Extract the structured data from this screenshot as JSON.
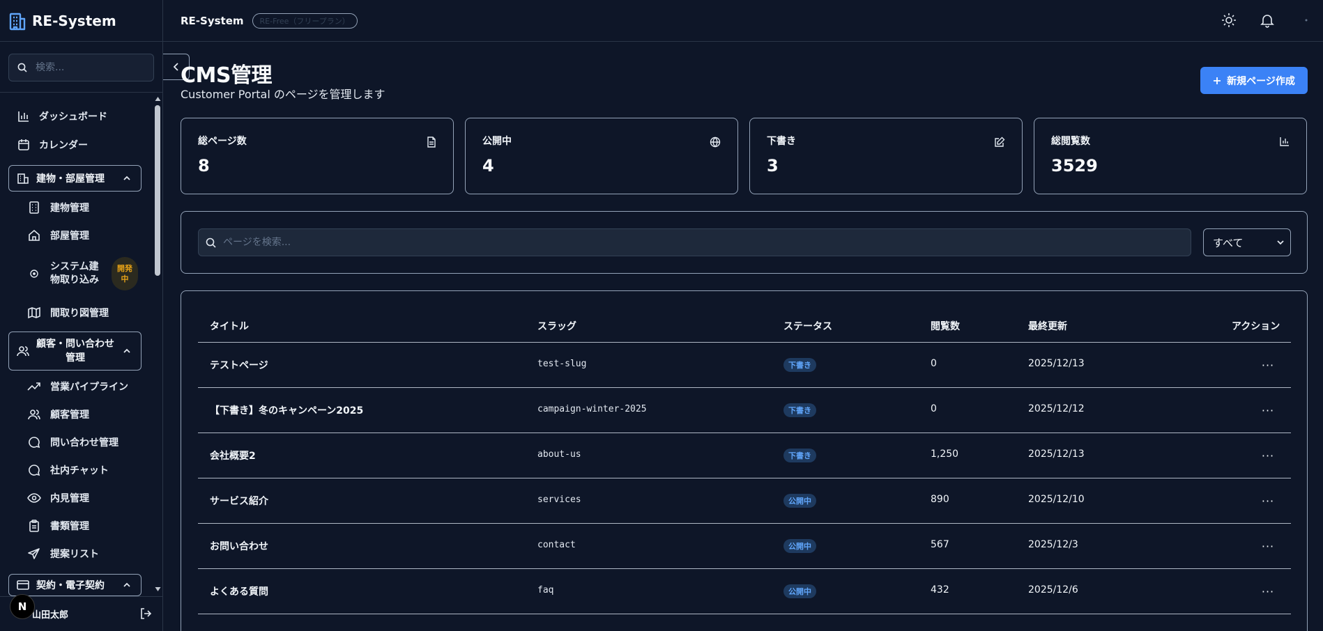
{
  "app": {
    "brand": "RE-System",
    "search_placeholder": "検索...",
    "user_name": "山田太郎",
    "next_badge": "N"
  },
  "nav": {
    "dashboard": "ダッシュボード",
    "calendar": "カレンダー",
    "group_building": "建物・部屋管理",
    "building": "建物管理",
    "room": "部屋管理",
    "import_line1": "システム建",
    "import_line2": "物取り込み",
    "dev_badge": "開発中",
    "floorplan": "間取り図管理",
    "group_customer_line1": "顧客・問い合わせ",
    "group_customer_line2": "管理",
    "pipeline": "営業パイプライン",
    "customers": "顧客管理",
    "inquiries": "問い合わせ管理",
    "chat": "社内チャット",
    "viewing": "内見管理",
    "documents": "書類管理",
    "proposals": "提案リスト",
    "group_contract": "契約・電子契約"
  },
  "topbar": {
    "title": "RE-System",
    "plan_badge": "RE-Free（フリープラン）"
  },
  "page": {
    "title": "CMS管理",
    "subtitle": "Customer Portal のページを管理します",
    "new_button": "新規ページ作成"
  },
  "stats": [
    {
      "label": "総ページ数",
      "value": "8",
      "icon": "file-text-icon"
    },
    {
      "label": "公開中",
      "value": "4",
      "icon": "globe-icon"
    },
    {
      "label": "下書き",
      "value": "3",
      "icon": "edit-icon"
    },
    {
      "label": "総閲覧数",
      "value": "3529",
      "icon": "bar-chart-icon"
    }
  ],
  "filter": {
    "search_placeholder": "ページを検索...",
    "status_value": "すべて"
  },
  "table": {
    "headers": {
      "title": "タイトル",
      "slug": "スラッグ",
      "status": "ステータス",
      "views": "閲覧数",
      "updated": "最終更新",
      "actions": "アクション"
    },
    "rows": [
      {
        "title": "テストページ",
        "slug": "test-slug",
        "status": "下書き",
        "views": "0",
        "updated": "2025/12/13",
        "action": "···"
      },
      {
        "title": "【下書き】冬のキャンペーン2025",
        "slug": "campaign-winter-2025",
        "status": "下書き",
        "views": "0",
        "updated": "2025/12/12",
        "action": "···"
      },
      {
        "title": "会社概要2",
        "slug": "about-us",
        "status": "下書き",
        "views": "1,250",
        "updated": "2025/12/13",
        "action": "···"
      },
      {
        "title": "サービス紹介",
        "slug": "services",
        "status": "公開中",
        "views": "890",
        "updated": "2025/12/10",
        "action": "···"
      },
      {
        "title": "お問い合わせ",
        "slug": "contact",
        "status": "公開中",
        "views": "567",
        "updated": "2025/12/3",
        "action": "···"
      },
      {
        "title": "よくある質問",
        "slug": "faq",
        "status": "公開中",
        "views": "432",
        "updated": "2025/12/6",
        "action": "···"
      }
    ]
  },
  "colors": {
    "background": "#0e1628",
    "primary": "#3b82f6",
    "badge_text": "#60a5fa",
    "dev_badge": "#e8a317"
  }
}
